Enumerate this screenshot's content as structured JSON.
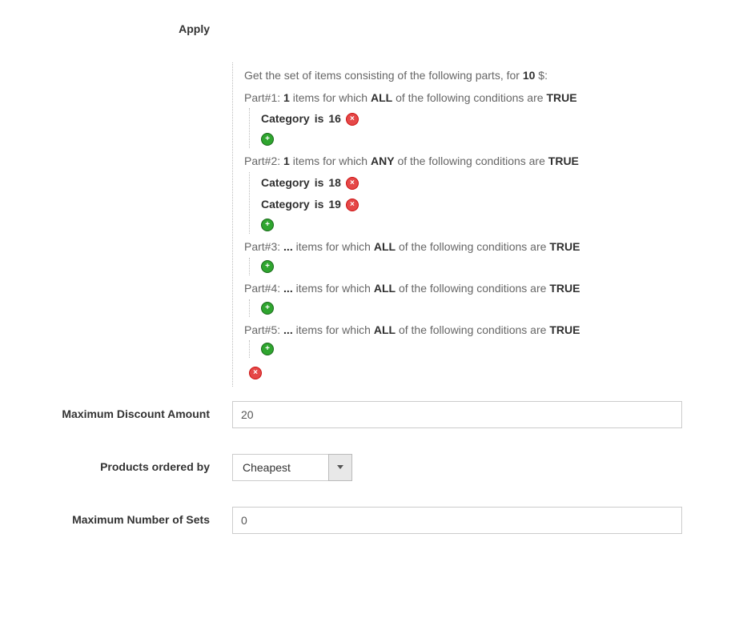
{
  "titles": {
    "apply": "Apply",
    "max_discount": "Maximum Discount Amount",
    "ordered_by": "Products ordered by",
    "max_sets": "Maximum Number of Sets"
  },
  "ruletree": {
    "intro_1": "Get the set of items consisting of the following parts, for ",
    "intro_price": "10",
    "intro_2": " $:",
    "part_prefix": "Part#",
    "items_for_which": " items for which ",
    "conditions_are": " of the following conditions are ",
    "true_word": "TRUE",
    "parts": [
      {
        "num": "1",
        "qty": "1",
        "aggregator": "ALL",
        "conditions": [
          {
            "attr": "Category",
            "op": "is",
            "val": "16"
          }
        ]
      },
      {
        "num": "2",
        "qty": "1",
        "aggregator": "ANY",
        "conditions": [
          {
            "attr": "Category",
            "op": "is",
            "val": "18"
          },
          {
            "attr": "Category",
            "op": "is",
            "val": "19"
          }
        ]
      },
      {
        "num": "3",
        "qty": "...",
        "aggregator": "ALL",
        "conditions": []
      },
      {
        "num": "4",
        "qty": "...",
        "aggregator": "ALL",
        "conditions": []
      },
      {
        "num": "5",
        "qty": "...",
        "aggregator": "ALL",
        "conditions": []
      }
    ]
  },
  "fields": {
    "max_discount": "20",
    "ordered_by": "Cheapest",
    "max_sets": "0"
  },
  "icons": {
    "add": "+",
    "remove": "×"
  }
}
